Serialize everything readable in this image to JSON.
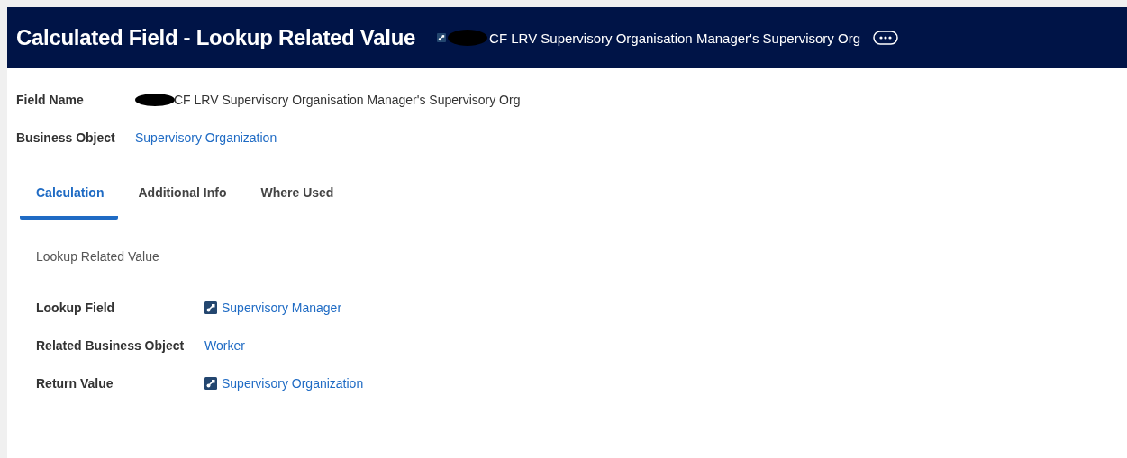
{
  "header": {
    "title": "Calculated Field - Lookup Related Value",
    "subtitle": "CF LRV Supervisory Organisation Manager's Supervisory Org",
    "redacted": true
  },
  "fields": [
    {
      "label": "Field Name",
      "kind": "text",
      "redacted": true,
      "value": "CF LRV Supervisory Organisation Manager's Supervisory Org"
    },
    {
      "label": "Business Object",
      "kind": "link",
      "redacted": false,
      "value": "Supervisory Organization"
    }
  ],
  "tabs": [
    {
      "label": "Calculation",
      "selected": true
    },
    {
      "label": "Additional Info",
      "selected": false
    },
    {
      "label": "Where Used",
      "selected": false
    }
  ],
  "section_title": "Lookup Related Value",
  "details": [
    {
      "label": "Lookup Field",
      "kind": "icon-link",
      "value": "Supervisory Manager"
    },
    {
      "label": "Related Business Object",
      "kind": "link",
      "value": "Worker"
    },
    {
      "label": "Return Value",
      "kind": "icon-link",
      "value": "Supervisory Organization"
    }
  ]
}
